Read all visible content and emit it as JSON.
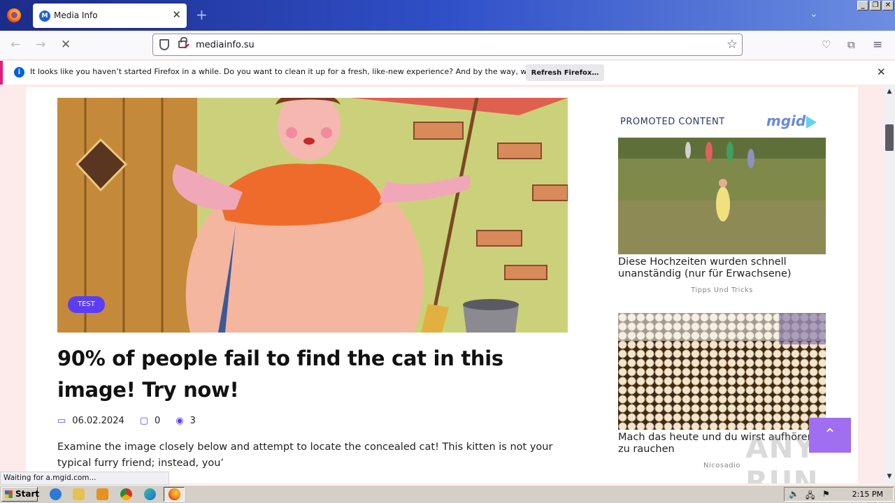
{
  "browser": {
    "tab_title": "Media Info",
    "tab_favicon_letter": "M",
    "url": "mediainfo.su",
    "status_text": "Waiting for a.mgid.com..."
  },
  "notification": {
    "text": "It looks like you haven’t started Firefox in a while. Do you want to clean it up for a fresh, like-new experience? And by the way, welcome back!",
    "button_label": "Refresh Firefox…"
  },
  "article": {
    "tag": "TEST",
    "headline": "90% of people fail to find the cat in this image! Try now!",
    "date": "06.02.2024",
    "comments": "0",
    "views": "3",
    "excerpt": "Examine the image closely below and attempt to locate the concealed cat! This kitten is not your typical furry friend; instead, you’"
  },
  "sidebar": {
    "promoted_label": "PROMOTED CONTENT",
    "brand": "mgid",
    "ads": [
      {
        "title": "Diese Hochzeiten wurden schnell unanständig (nur für Erwachsene)",
        "source": "Tipps Und Tricks"
      },
      {
        "title": "Mach das heute und du wirst aufhören zu rauchen",
        "source": "Nicosadio"
      }
    ]
  },
  "watermark": "ANY RUN",
  "taskbar": {
    "start_label": "Start",
    "clock": "2:15 PM"
  },
  "colors": {
    "accent": "#5b3ef4",
    "scroll_top_button": "#a06ef0",
    "page_background": "#fdeaea"
  }
}
